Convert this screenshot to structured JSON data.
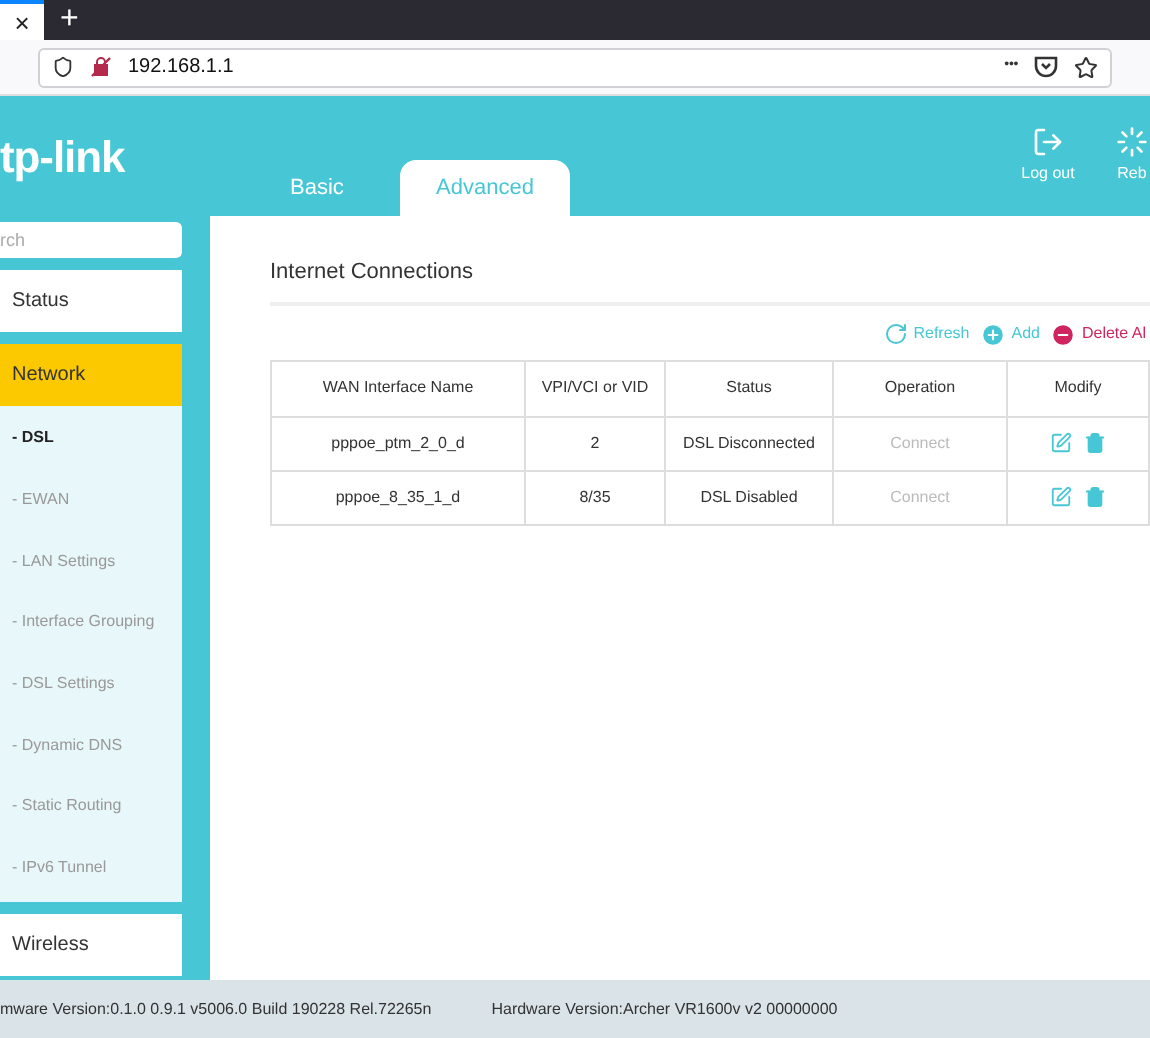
{
  "browser": {
    "tab_close": "×",
    "new_tab": "+",
    "url": "192.168.1.1",
    "more": "•••"
  },
  "header": {
    "logo": "tp-link",
    "tabs": [
      {
        "label": "Basic",
        "selected": false
      },
      {
        "label": "Advanced",
        "selected": true
      }
    ],
    "actions": [
      {
        "label": "Log out",
        "kind": "logout"
      },
      {
        "label": "Reb",
        "kind": "reboot"
      }
    ]
  },
  "sidebar": {
    "search": {
      "placeholder": "rch"
    },
    "items": [
      {
        "label": "Status",
        "selected": false
      },
      {
        "label": "Network",
        "selected": true,
        "children": [
          {
            "label": "- DSL",
            "selected": true
          },
          {
            "label": "- EWAN",
            "selected": false
          },
          {
            "label": "- LAN Settings",
            "selected": false
          },
          {
            "label": "- Interface Grouping",
            "selected": false
          },
          {
            "label": "- DSL Settings",
            "selected": false
          },
          {
            "label": "- Dynamic DNS",
            "selected": false
          },
          {
            "label": "- Static Routing",
            "selected": false
          },
          {
            "label": "- IPv6 Tunnel",
            "selected": false
          }
        ]
      },
      {
        "label": "Wireless",
        "selected": false
      }
    ]
  },
  "main": {
    "title": "Internet Connections",
    "toolbar": [
      {
        "label": "Refresh",
        "kind": "refresh"
      },
      {
        "label": "Add",
        "kind": "add"
      },
      {
        "label": "Delete Al",
        "kind": "delete"
      }
    ],
    "table": {
      "columns": [
        "WAN Interface Name",
        "VPI/VCI or VID",
        "Status",
        "Operation",
        "Modify"
      ],
      "rows": [
        {
          "name": "pppoe_ptm_2_0_d",
          "vid": "2",
          "status": "DSL Disconnected",
          "operation": "Connect",
          "disabled": true
        },
        {
          "name": "pppoe_8_35_1_d",
          "vid": "8/35",
          "status": "DSL Disabled",
          "operation": "Connect",
          "disabled": true
        }
      ]
    }
  },
  "status_bar": {
    "firmware": "mware Version:0.1.0 0.9.1 v5006.0 Build 190228 Rel.72265n",
    "hardware": "Hardware Version:Archer VR1600v v2 00000000"
  }
}
